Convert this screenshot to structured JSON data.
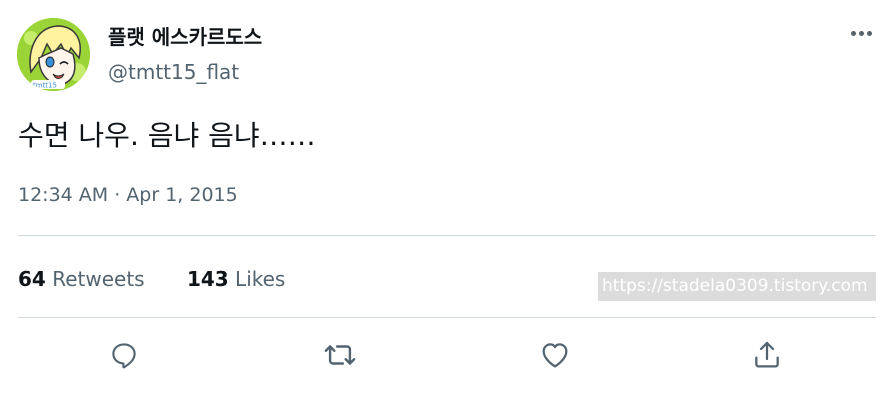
{
  "tweet": {
    "author": {
      "display_name": "플랫 에스카르도스",
      "handle": "@tmtt15_flat"
    },
    "text": "수면 나우. 음냐 음냐……",
    "timestamp": "12:34 AM · Apr 1, 2015",
    "stats": {
      "retweets_count": "64",
      "retweets_label": "Retweets",
      "likes_count": "143",
      "likes_label": "Likes"
    },
    "actions": [
      "reply-icon",
      "retweet-icon",
      "like-icon",
      "share-icon"
    ]
  },
  "watermark": "https://stadela0309.tistory.com",
  "colors": {
    "primary_text": "#0f1419",
    "secondary_text": "#536471",
    "divider": "#cfd9de",
    "avatar_background": "#9bd437"
  }
}
